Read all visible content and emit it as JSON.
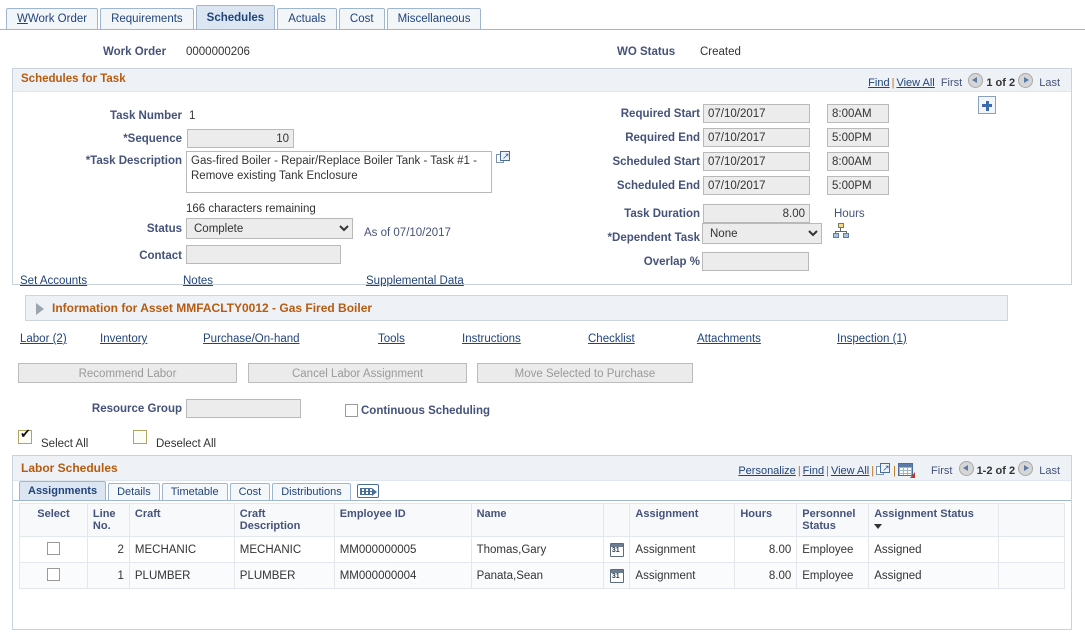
{
  "top_tabs": [
    {
      "label": "Work Order",
      "accel": "W",
      "active": false
    },
    {
      "label": "Requirements",
      "accel": "q",
      "active": false
    },
    {
      "label": "Schedules",
      "accel": "",
      "active": true
    },
    {
      "label": "Actuals",
      "accel": "u",
      "active": false
    },
    {
      "label": "Cost",
      "accel": "C",
      "active": false
    },
    {
      "label": "Miscellaneous",
      "accel": "l",
      "active": false
    }
  ],
  "header": {
    "work_order_label": "Work Order",
    "work_order_value": "0000000206",
    "wo_status_label": "WO Status",
    "wo_status_value": "Created"
  },
  "schedules_for_task": {
    "title": "Schedules for Task",
    "nav": {
      "find": "Find",
      "view_all": "View All",
      "first": "First",
      "counter": "1 of 2",
      "last": "Last"
    },
    "add_button_label": "+",
    "left": {
      "task_number_label": "Task Number",
      "task_number_value": "1",
      "sequence_label": "*Sequence",
      "sequence_value": "10",
      "task_description_label": "*Task Description",
      "task_description_value": "Gas-fired Boiler - Repair/Replace Boiler Tank - Task #1 - Remove existing Tank Enclosure",
      "chars_remaining": "166 characters remaining",
      "status_label": "Status",
      "status_value": "Complete",
      "status_options": [
        "Complete"
      ],
      "as_of": "As of 07/10/2017",
      "contact_label": "Contact",
      "contact_value": ""
    },
    "right": {
      "required_start_label": "Required Start",
      "required_start_date": "07/10/2017",
      "required_start_time": "8:00AM",
      "required_end_label": "Required End",
      "required_end_date": "07/10/2017",
      "required_end_time": "5:00PM",
      "scheduled_start_label": "Scheduled Start",
      "scheduled_start_date": "07/10/2017",
      "scheduled_start_time": "8:00AM",
      "scheduled_end_label": "Scheduled End",
      "scheduled_end_date": "07/10/2017",
      "scheduled_end_time": "5:00PM",
      "task_duration_label": "Task Duration",
      "task_duration_value": "8.00",
      "hours_label": "Hours",
      "dependent_task_label": "*Dependent Task",
      "dependent_task_value": "None",
      "dependent_task_options": [
        "None"
      ],
      "overlap_label": "Overlap %",
      "overlap_value": ""
    },
    "bottom_links": [
      {
        "label": "Set Accounts"
      },
      {
        "label": "Notes"
      },
      {
        "label": "Supplemental Data"
      }
    ]
  },
  "asset_section": {
    "title": "Information for Asset MMFACLTY0012 - Gas Fired Boiler",
    "expanded": false
  },
  "resource_links": [
    {
      "label": "Labor (2)"
    },
    {
      "label": "Inventory"
    },
    {
      "label": "Purchase/On-hand"
    },
    {
      "label": "Tools"
    },
    {
      "label": "Instructions"
    },
    {
      "label": "Checklist"
    },
    {
      "label": "Attachments"
    },
    {
      "label": "Inspection (1)"
    }
  ],
  "action_buttons": [
    {
      "label": "Recommend Labor",
      "disabled": true
    },
    {
      "label": "Cancel Labor Assignment",
      "disabled": true
    },
    {
      "label": "Move Selected to Purchase",
      "disabled": true
    }
  ],
  "resource_group": {
    "label": "Resource Group",
    "value": "",
    "continuous_scheduling_label": "Continuous Scheduling",
    "continuous_scheduling_checked": false,
    "select_all_label": "Select All",
    "select_all_checked": true,
    "deselect_all_label": "Deselect All",
    "deselect_all_checked": false
  },
  "labor_schedules": {
    "title": "Labor Schedules",
    "toolbar": {
      "personalize": "Personalize",
      "find": "Find",
      "view_all": "View All",
      "first": "First",
      "counter": "1-2 of 2",
      "last": "Last"
    },
    "subtabs": [
      {
        "label": "Assignments",
        "accel": "",
        "active": true
      },
      {
        "label": "Details",
        "accel": "D",
        "active": false
      },
      {
        "label": "Timetable",
        "accel": "T",
        "active": false
      },
      {
        "label": "Cost",
        "accel": "C",
        "active": false
      },
      {
        "label": "Distributions",
        "accel": "D",
        "active": false
      }
    ],
    "columns": [
      "Select",
      "Line No.",
      "Craft",
      "Craft Description",
      "Employee ID",
      "Name",
      "",
      "Assignment",
      "Hours",
      "Personnel Status",
      "Assignment Status",
      ""
    ],
    "sorted_column": "Assignment Status",
    "rows": [
      {
        "selected": false,
        "line_no": "2",
        "craft": "MECHANIC",
        "craft_description": "MECHANIC",
        "employee_id": "MM000000005",
        "name": "Thomas,Gary",
        "calendar_icon": "calendar-icon",
        "assignment": "Assignment",
        "hours": "8.00",
        "personnel_status": "Employee",
        "assignment_status": "Assigned"
      },
      {
        "selected": false,
        "line_no": "1",
        "craft": "PLUMBER",
        "craft_description": "PLUMBER",
        "employee_id": "MM000000004",
        "name": "Panata,Sean",
        "calendar_icon": "calendar-icon",
        "assignment": "Assignment",
        "hours": "8.00",
        "personnel_status": "Employee",
        "assignment_status": "Assigned"
      }
    ]
  },
  "colors": {
    "group_title": "#b75b10",
    "label": "#45527a",
    "link": "#22447a",
    "tab_active_bg": "#dce6f2",
    "accent_plus": "#3c6ab0"
  }
}
